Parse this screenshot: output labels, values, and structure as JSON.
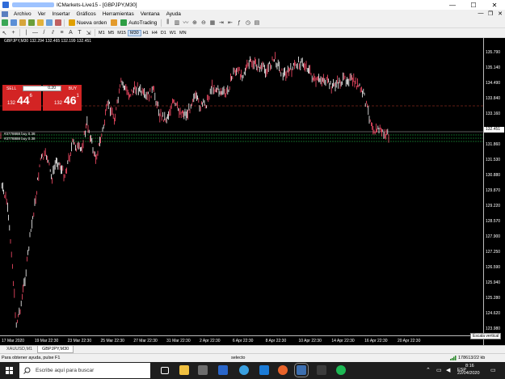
{
  "window": {
    "title": "ICMarkets-Live15 - [GBPJPY,M30]",
    "controls": [
      "—",
      "☐",
      "✕"
    ],
    "mdi_controls": [
      "—",
      "❐",
      "✕"
    ]
  },
  "menu": [
    "Archivo",
    "Ver",
    "Insertar",
    "Gráficos",
    "Herramientas",
    "Ventana",
    "Ayuda"
  ],
  "toolbar": {
    "new_order": "Nueva orden",
    "autotrading": "AutoTrading",
    "timeframes": [
      "M1",
      "M5",
      "M15",
      "M30",
      "H1",
      "H4",
      "D1",
      "W1",
      "MN"
    ],
    "active_timeframe": "M30"
  },
  "chart": {
    "caption": "GBPJPY,M30  132.294 132.465 132.199 132.451",
    "price_scale": [
      "135.790",
      "135.140",
      "134.490",
      "133.840",
      "133.160",
      "132.451",
      "131.860",
      "131.530",
      "130.880",
      "129.870",
      "129.220",
      "128.570",
      "127.900",
      "127.250",
      "126.590",
      "125.940",
      "125.280",
      "124.620",
      "123.980"
    ],
    "current_price": "132.451",
    "time_axis": [
      "17 Mar 2020",
      "19 Mar 22:30",
      "23 Mar 22:30",
      "25 Mar 22:30",
      "27 Mar 22:30",
      "31 Mar 22:30",
      "2 Apr 22:30",
      "6 Apr 22:30",
      "8 Apr 22:30",
      "10 Apr 22:30",
      "14 Apr 22:30",
      "16 Apr 22:30",
      "20 Apr 22:30"
    ],
    "tooltip": "Escala vertical",
    "line_labels": {
      "tp": "#3778888 tp",
      "entry1": "#3778888 buy 0.38",
      "entry2": "#3778888 buy 0.38"
    },
    "colors": {
      "background": "#000000",
      "candle": "#ffffff",
      "candle_alt": "#ff4d6a",
      "tp_line": "#c0392b",
      "entry_line": "#21c44a",
      "current_line": "#bbbbbb"
    }
  },
  "one_click": {
    "sell_label": "SELL",
    "buy_label": "BUY",
    "lot": "0.20",
    "sell_price_small": "132",
    "sell_price_big": "44",
    "sell_price_sup": "6",
    "buy_price_small": "132",
    "buy_price_big": "46",
    "buy_price_sup": "1"
  },
  "tabs": [
    "XAUUSD,M1",
    "GBPJPY,M30"
  ],
  "active_tab": "GBPJPY,M30",
  "status": {
    "help": "Para obtener ayuda, pulse F1",
    "selection": "selecto",
    "connection": "178613/22 kb"
  },
  "taskbar": {
    "search_placeholder": "Escribe aquí para buscar",
    "time": "8:16",
    "date": "22/04/2020",
    "language": "ESP"
  }
}
